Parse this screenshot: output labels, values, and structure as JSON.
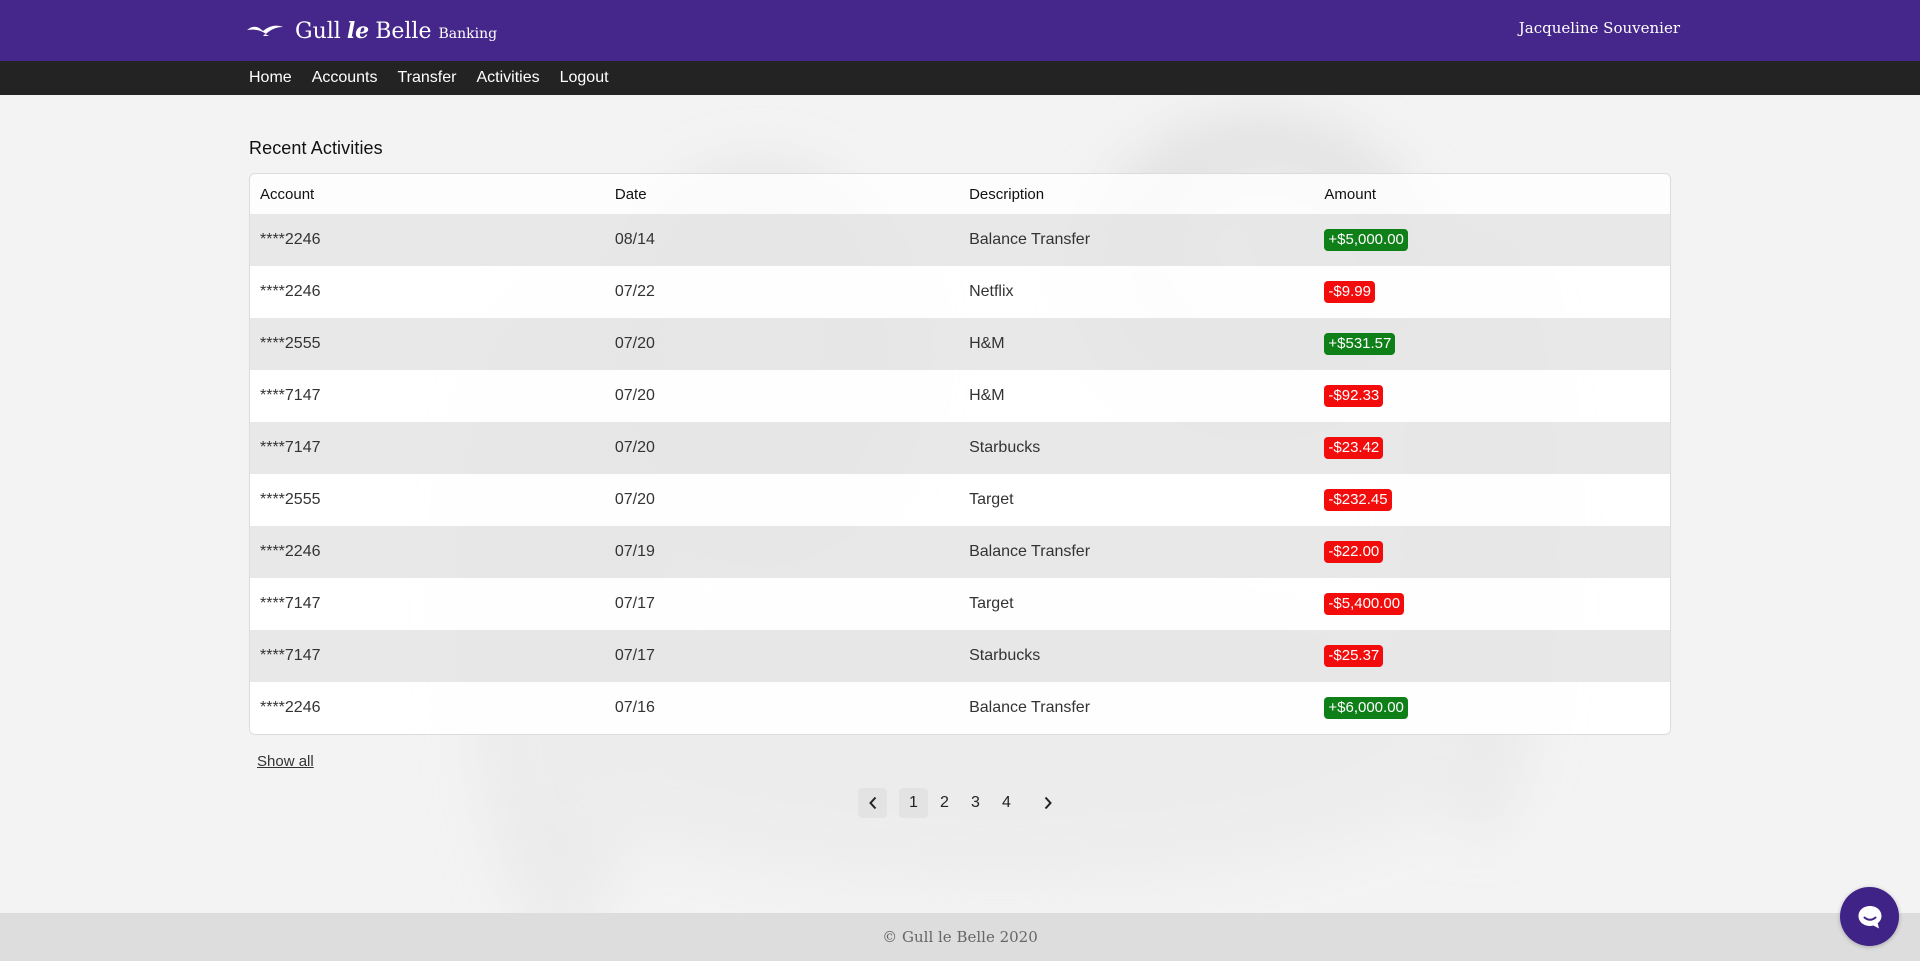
{
  "brand": {
    "name_left": "Gull",
    "name_mid": "le",
    "name_right": "Belle",
    "subtitle": "Banking",
    "color": "#45268a"
  },
  "user": {
    "name": "Jacqueline Souvenier"
  },
  "nav": {
    "items": [
      {
        "label": "Home"
      },
      {
        "label": "Accounts"
      },
      {
        "label": "Transfer"
      },
      {
        "label": "Activities"
      },
      {
        "label": "Logout"
      }
    ]
  },
  "activities": {
    "title": "Recent Activities",
    "columns": [
      "Account",
      "Date",
      "Description",
      "Amount"
    ],
    "rows": [
      {
        "account": "****2246",
        "date": "08/14",
        "description": "Balance Transfer",
        "amount": "+$5,000.00",
        "sign": "positive"
      },
      {
        "account": "****2246",
        "date": "07/22",
        "description": "Netflix",
        "amount": "-$9.99",
        "sign": "negative"
      },
      {
        "account": "****2555",
        "date": "07/20",
        "description": "H&M",
        "amount": "+$531.57",
        "sign": "positive"
      },
      {
        "account": "****7147",
        "date": "07/20",
        "description": "H&M",
        "amount": "-$92.33",
        "sign": "negative"
      },
      {
        "account": "****7147",
        "date": "07/20",
        "description": "Starbucks",
        "amount": "-$23.42",
        "sign": "negative"
      },
      {
        "account": "****2555",
        "date": "07/20",
        "description": "Target",
        "amount": "-$232.45",
        "sign": "negative"
      },
      {
        "account": "****2246",
        "date": "07/19",
        "description": "Balance Transfer",
        "amount": "-$22.00",
        "sign": "negative"
      },
      {
        "account": "****7147",
        "date": "07/17",
        "description": "Target",
        "amount": "-$5,400.00",
        "sign": "negative"
      },
      {
        "account": "****7147",
        "date": "07/17",
        "description": "Starbucks",
        "amount": "-$25.37",
        "sign": "negative"
      },
      {
        "account": "****2246",
        "date": "07/16",
        "description": "Balance Transfer",
        "amount": "+$6,000.00",
        "sign": "positive"
      }
    ],
    "show_all_label": "Show all"
  },
  "pagination": {
    "pages": [
      "1",
      "2",
      "3",
      "4"
    ],
    "current": "1",
    "prev_icon": "chevron-left-icon",
    "next_icon": "chevron-right-icon"
  },
  "footer": {
    "text": "© Gull le Belle 2020"
  },
  "chat": {
    "icon": "chat-bubble-icon",
    "color": "#3f2387"
  },
  "colors": {
    "positive": "#0f7f18",
    "negative": "#f20c0c",
    "navbar": "#232323"
  }
}
